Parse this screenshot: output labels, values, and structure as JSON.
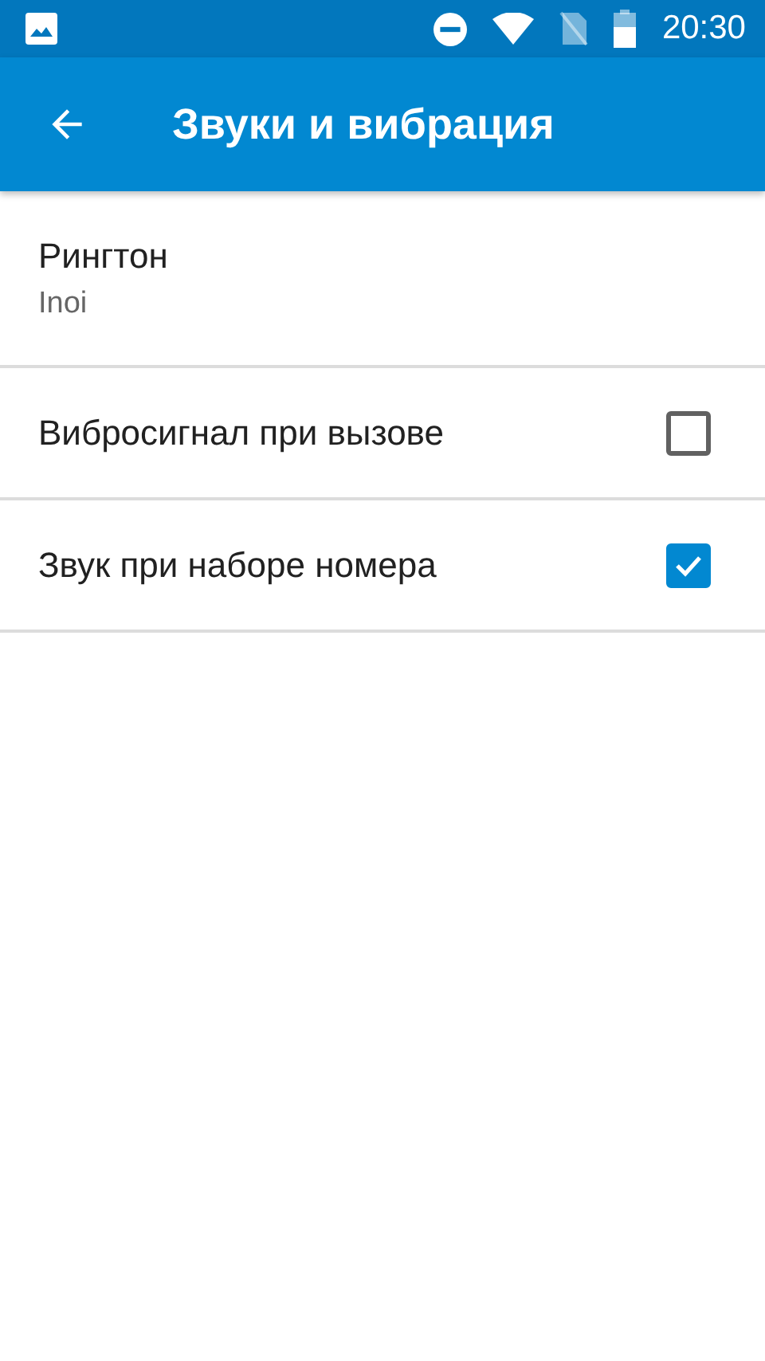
{
  "status_bar": {
    "time": "20:30"
  },
  "app_bar": {
    "title": "Звуки и вибрация"
  },
  "settings": [
    {
      "kind": "text",
      "title": "Рингтон",
      "summary": "Inoi"
    },
    {
      "kind": "checkbox",
      "title": "Вибросигнал при вызове",
      "checked": false
    },
    {
      "kind": "checkbox",
      "title": "Звук при наборе номера",
      "checked": true
    }
  ]
}
